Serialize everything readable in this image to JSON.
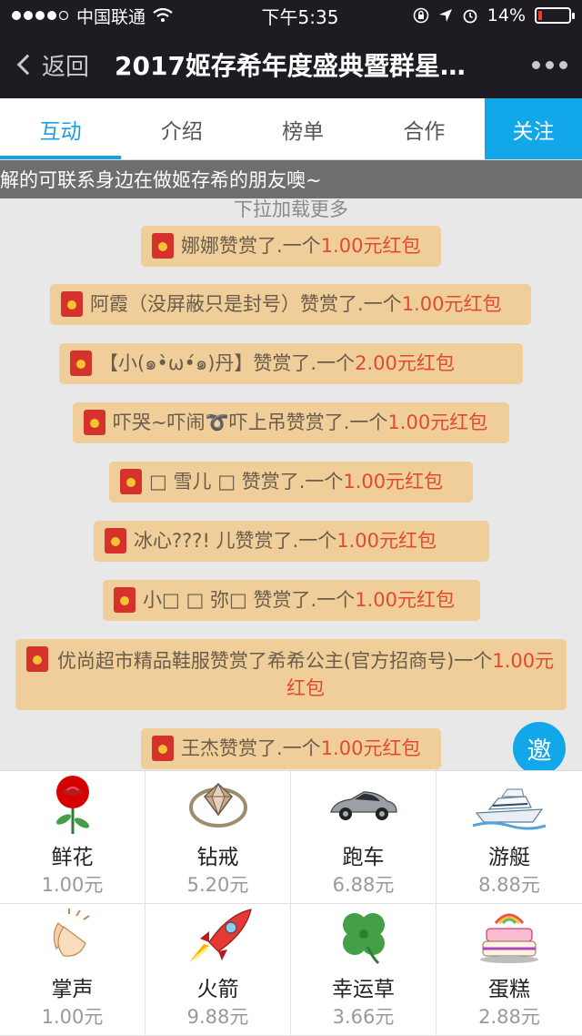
{
  "status": {
    "carrier": "中国联通",
    "time": "下午5:35",
    "battery": "14%",
    "battery_level": 0.14
  },
  "nav": {
    "back_label": "返回",
    "title": "2017姬存希年度盛典暨群星…"
  },
  "tabs": [
    {
      "label": "互动"
    },
    {
      "label": "介绍"
    },
    {
      "label": "榜单"
    },
    {
      "label": "合作"
    },
    {
      "label": "关注"
    }
  ],
  "marquee": "解的可联系身边在做姬存希的朋友噢~",
  "loadmore": "下拉加载更多",
  "messages": [
    {
      "text": "娜娜赞赏了.一个",
      "amount": "1.00元红包"
    },
    {
      "text": "阿霞（没屏蔽只是封号）赞赏了.一个",
      "amount": "1.00元红包"
    },
    {
      "text": "【小(๑•̀ω•́๑)丹】赞赏了.一个",
      "amount": "2.00元红包"
    },
    {
      "text": "吓哭~吓闹➰吓上吊赞赏了.一个",
      "amount": "1.00元红包"
    },
    {
      "text": "□ 雪儿 □ 赞赏了.一个",
      "amount": "1.00元红包"
    },
    {
      "text": "冰心???!      儿赞赏了.一个",
      "amount": "1.00元红包"
    },
    {
      "text": "小□ □ 弥□ 赞赏了.一个",
      "amount": "1.00元红包"
    },
    {
      "text": "优尚超市精品鞋服赞赏了希希公主(官方招商号)一个",
      "amount": "1.00元红包"
    },
    {
      "text": "王杰赞赏了.一个",
      "amount": "1.00元红包"
    }
  ],
  "invite_label": "邀",
  "gifts": [
    {
      "name": "鲜花",
      "price": "1.00元",
      "icon": "rose-icon"
    },
    {
      "name": "钻戒",
      "price": "5.20元",
      "icon": "diamond-ring-icon"
    },
    {
      "name": "跑车",
      "price": "6.88元",
      "icon": "sports-car-icon"
    },
    {
      "name": "游艇",
      "price": "8.88元",
      "icon": "yacht-icon"
    },
    {
      "name": "掌声",
      "price": "1.00元",
      "icon": "clapping-hands-icon"
    },
    {
      "name": "火箭",
      "price": "9.88元",
      "icon": "rocket-icon"
    },
    {
      "name": "幸运草",
      "price": "3.66元",
      "icon": "clover-icon"
    },
    {
      "name": "蛋糕",
      "price": "2.88元",
      "icon": "cake-icon"
    }
  ],
  "colors": {
    "accent": "#12a7e8",
    "message_bg": "#efce9a",
    "amount": "#e2492f",
    "header_bg": "#1f1b22"
  }
}
